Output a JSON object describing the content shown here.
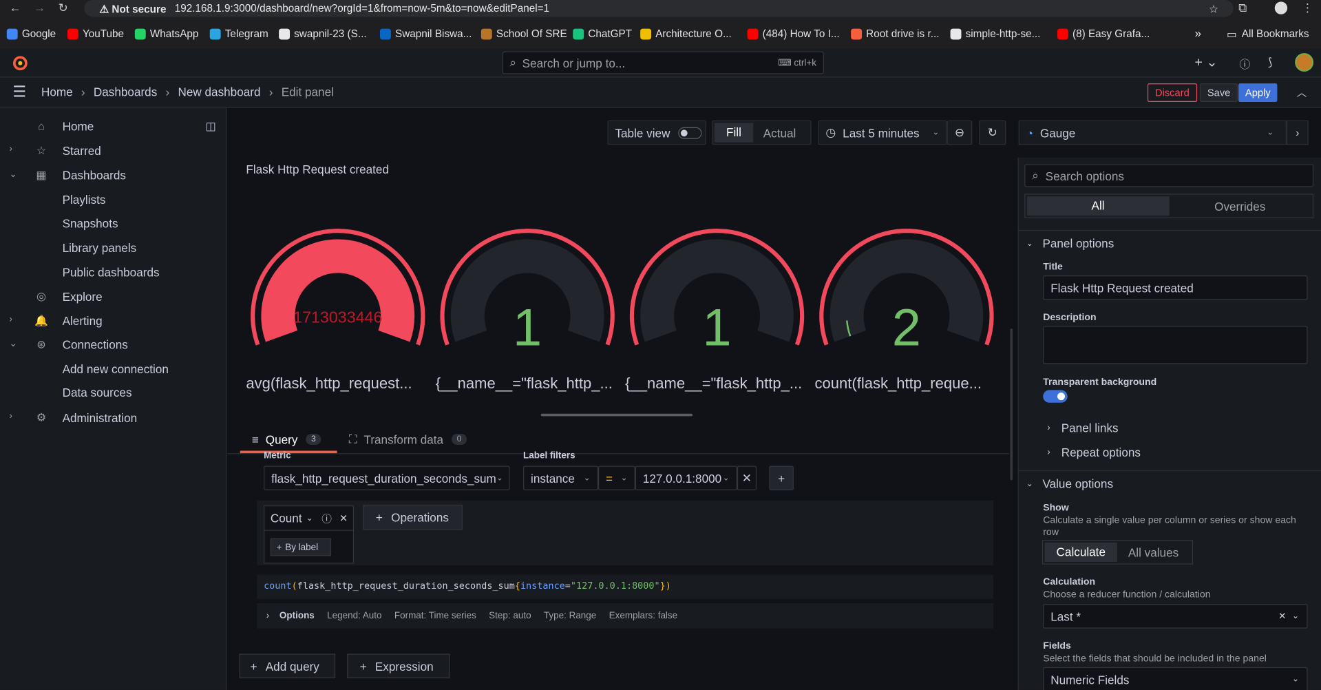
{
  "browser": {
    "not_secure": "Not secure",
    "url": "192.168.1.9:3000/dashboard/new?orgId=1&from=now-5m&to=now&editPanel=1",
    "bookmarks": [
      "Google",
      "YouTube",
      "WhatsApp",
      "Telegram",
      "swapnil-23 (S...",
      "Swapnil Biswa...",
      "School Of SRE",
      "ChatGPT",
      "Architecture O...",
      "(484) How To I...",
      "Root drive is r...",
      "simple-http-se...",
      "(8) Easy Grafa..."
    ],
    "all_bookmarks": "All Bookmarks",
    "more": "»"
  },
  "topbar": {
    "search_placeholder": "Search or jump to...",
    "shortcut": "ctrl+k"
  },
  "breadcrumb": {
    "home": "Home",
    "dashboards": "Dashboards",
    "new_dashboard": "New dashboard",
    "edit_panel": "Edit panel",
    "sep": "›"
  },
  "actions": {
    "discard": "Discard",
    "save": "Save",
    "apply": "Apply"
  },
  "sidebar": {
    "items": [
      "Home",
      "Starred",
      "Dashboards",
      "Playlists",
      "Snapshots",
      "Library panels",
      "Public dashboards",
      "Explore",
      "Alerting",
      "Connections",
      "Add new connection",
      "Data sources",
      "Administration"
    ]
  },
  "panel_toolbar": {
    "table_view": "Table view",
    "fill": "Fill",
    "actual": "Actual",
    "time_range": "Last 5 minutes"
  },
  "panel": {
    "title": "Flask Http Request created",
    "gauges": [
      {
        "value": "1713033446",
        "label": "avg(flask_http_request...",
        "fill": 1.0,
        "value_color": "#f2495c"
      },
      {
        "value": "1",
        "label": "{__name__=\"flask_http_...",
        "fill": 0.0,
        "value_color": "#73bf69"
      },
      {
        "value": "1",
        "label": "{__name__=\"flask_http_...",
        "fill": 0.0,
        "value_color": "#73bf69"
      },
      {
        "value": "2",
        "label": "count(flask_http_reque...",
        "fill": 0.07,
        "value_color": "#73bf69"
      }
    ]
  },
  "query_tabs": {
    "query": "Query",
    "query_count": "3",
    "transform": "Transform data",
    "transform_count": "0"
  },
  "query": {
    "metric_label": "Metric",
    "label_filters_label": "Label filters",
    "metric": "flask_http_request_duration_seconds_sum",
    "label_key": "instance",
    "operator": "=",
    "label_value": "127.0.0.1:8000",
    "operation": "Count",
    "operations_btn": "Operations",
    "by_label": "By label",
    "promql": {
      "fn": "count",
      "open": "(",
      "metric": "flask_http_request_duration_seconds_sum",
      "lbrace": "{",
      "key": "instance",
      "eq": "=",
      "val": "\"127.0.0.1:8000\"",
      "close": "})"
    },
    "options": {
      "title": "Options",
      "legend": "Legend: Auto",
      "format": "Format: Time series",
      "step": "Step: auto",
      "type": "Type: Range",
      "exemplars": "Exemplars: false"
    },
    "add_query": "Add query",
    "expression": "Expression"
  },
  "options_pane": {
    "viz": "Gauge",
    "search_placeholder": "Search options",
    "tab_all": "All",
    "tab_overrides": "Overrides",
    "panel_options": "Panel options",
    "title_label": "Title",
    "title_value": "Flask Http Request created",
    "description_label": "Description",
    "transparent_label": "Transparent background",
    "panel_links": "Panel links",
    "repeat_options": "Repeat options",
    "value_options": "Value options",
    "show_label": "Show",
    "show_desc": "Calculate a single value per column or series or show each row",
    "calculate": "Calculate",
    "all_values": "All values",
    "calculation_label": "Calculation",
    "calculation_desc": "Choose a reducer function / calculation",
    "calculation_value": "Last *",
    "fields_label": "Fields",
    "fields_desc": "Select the fields that should be included in the panel",
    "fields_value": "Numeric Fields"
  },
  "colors": {
    "red": "#f2495c",
    "green": "#73bf69",
    "blue": "#3d71d9",
    "accent": "#f55f3e"
  }
}
